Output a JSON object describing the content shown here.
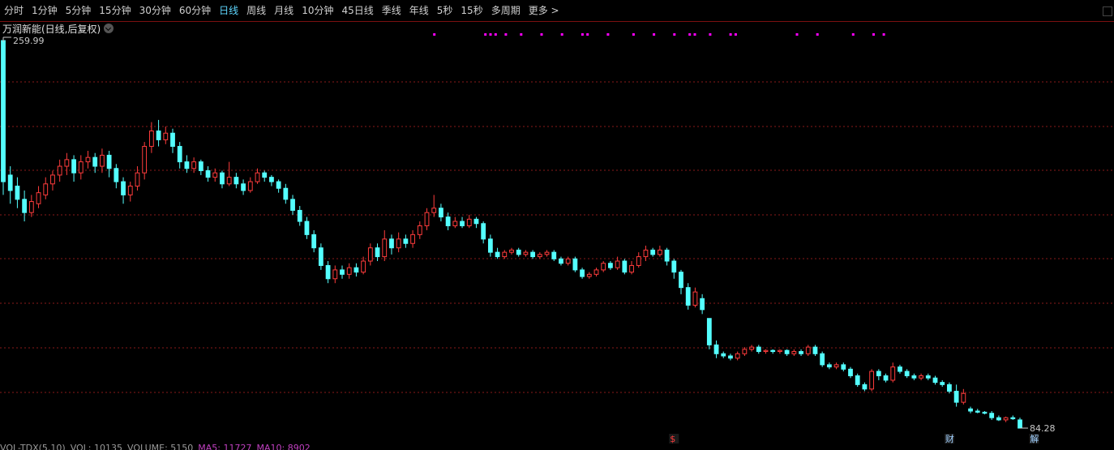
{
  "toolbar": {
    "tabs": [
      "分时",
      "1分钟",
      "5分钟",
      "15分钟",
      "30分钟",
      "60分钟",
      "日线",
      "周线",
      "月线",
      "10分钟",
      "45日线",
      "季线",
      "年线",
      "5秒",
      "15秒",
      "多周期",
      "更多 >"
    ],
    "active": "日线"
  },
  "title": "万润新能(日线,后复权)",
  "colors": {
    "up": "#ff3c3c",
    "down": "#54ffff",
    "grid": "#8a1a1a",
    "signal": "#ff00ff",
    "text": "#c8c8c8"
  },
  "labels": {
    "high": "259.99",
    "low": "84.28"
  },
  "markers": [
    {
      "text": "$",
      "color": "#ff3c3c",
      "index": 95
    },
    {
      "text": "财",
      "color": "#a0d0ff",
      "index": 134
    },
    {
      "text": "解",
      "color": "#a0d0ff",
      "index": 146
    }
  ],
  "bottom_indicators": [
    "VOL-TDX(5,10)",
    "VOL: 10135",
    "VOLUME: 5150",
    "MA5: 11727",
    "MA10: 8902"
  ],
  "chart_data": {
    "type": "candlestick",
    "title": "万润新能(日线,后复权)",
    "y_range": [
      84.28,
      259.99
    ],
    "max_label": 259.99,
    "min_label": 84.28,
    "candles": [
      [
        259.99,
        196.0,
        259.99,
        190.0
      ],
      [
        199.0,
        192.0,
        203.0,
        186.0
      ],
      [
        194.0,
        188.0,
        198.0,
        184.0
      ],
      [
        188.0,
        182.0,
        192.0,
        178.0
      ],
      [
        182.0,
        187.0,
        190.0,
        180.0
      ],
      [
        186.0,
        191.0,
        194.0,
        184.0
      ],
      [
        190.0,
        195.0,
        198.0,
        188.0
      ],
      [
        195.0,
        199.0,
        201.0,
        192.0
      ],
      [
        199.0,
        203.0,
        206.0,
        196.0
      ],
      [
        203.0,
        206.0,
        209.0,
        199.0
      ],
      [
        206.0,
        200.0,
        208.0,
        196.0
      ],
      [
        200.0,
        205.0,
        208.0,
        197.0
      ],
      [
        205.0,
        207.0,
        210.0,
        202.0
      ],
      [
        207.0,
        203.0,
        209.0,
        200.0
      ],
      [
        203.0,
        208.0,
        211.0,
        200.0
      ],
      [
        208.0,
        202.0,
        210.0,
        198.0
      ],
      [
        202.0,
        196.0,
        204.0,
        193.0
      ],
      [
        196.0,
        190.0,
        198.0,
        186.0
      ],
      [
        190.0,
        194.0,
        196.0,
        187.0
      ],
      [
        194.0,
        200.0,
        203.0,
        192.0
      ],
      [
        200.0,
        212.0,
        214.0,
        197.0
      ],
      [
        212.0,
        219.0,
        223.0,
        209.0
      ],
      [
        219.0,
        215.0,
        224.0,
        212.0
      ],
      [
        215.0,
        218.0,
        221.0,
        213.0
      ],
      [
        218.0,
        212.0,
        220.0,
        209.0
      ],
      [
        212.0,
        205.0,
        214.0,
        202.0
      ],
      [
        205.0,
        202.0,
        208.0,
        200.0
      ],
      [
        202.0,
        205.0,
        207.0,
        200.0
      ],
      [
        205.0,
        201.0,
        206.0,
        199.0
      ],
      [
        201.0,
        198.0,
        203.0,
        196.0
      ],
      [
        198.0,
        200.0,
        202.0,
        196.0
      ],
      [
        200.0,
        195.0,
        201.0,
        193.0
      ],
      [
        195.0,
        198.0,
        205.0,
        194.0
      ],
      [
        198.0,
        195.0,
        200.0,
        193.0
      ],
      [
        195.0,
        192.0,
        197.0,
        190.0
      ],
      [
        192.0,
        196.0,
        198.0,
        191.0
      ],
      [
        196.0,
        200.0,
        202.0,
        195.0
      ],
      [
        200.0,
        198.0,
        201.0,
        196.0
      ],
      [
        198.0,
        196.0,
        199.0,
        194.0
      ],
      [
        196.0,
        193.0,
        197.0,
        191.0
      ],
      [
        193.0,
        188.0,
        195.0,
        186.0
      ],
      [
        188.0,
        183.0,
        190.0,
        181.0
      ],
      [
        183.0,
        178.0,
        185.0,
        176.0
      ],
      [
        178.0,
        172.0,
        180.0,
        170.0
      ],
      [
        172.0,
        166.0,
        174.0,
        164.0
      ],
      [
        166.0,
        158.0,
        168.0,
        156.0
      ],
      [
        158.0,
        152.0,
        160.0,
        150.0
      ],
      [
        152.0,
        156.0,
        158.0,
        150.0
      ],
      [
        156.0,
        154.0,
        158.0,
        152.0
      ],
      [
        154.0,
        157.0,
        159.0,
        152.0
      ],
      [
        157.0,
        155.0,
        159.0,
        153.0
      ],
      [
        155.0,
        160.0,
        162.0,
        154.0
      ],
      [
        160.0,
        166.0,
        168.0,
        158.0
      ],
      [
        166.0,
        162.0,
        168.0,
        160.0
      ],
      [
        162.0,
        170.0,
        174.0,
        160.0
      ],
      [
        170.0,
        166.0,
        172.0,
        163.0
      ],
      [
        166.0,
        170.0,
        173.0,
        164.0
      ],
      [
        170.0,
        168.0,
        172.0,
        166.0
      ],
      [
        168.0,
        172.0,
        174.0,
        166.0
      ],
      [
        172.0,
        176.0,
        178.0,
        170.0
      ],
      [
        176.0,
        182.0,
        184.0,
        174.0
      ],
      [
        182.0,
        184.0,
        190.0,
        180.0
      ],
      [
        184.0,
        180.0,
        186.0,
        178.0
      ],
      [
        180.0,
        176.0,
        182.0,
        174.0
      ],
      [
        176.0,
        178.0,
        180.0,
        175.0
      ],
      [
        178.0,
        176.0,
        180.0,
        175.0
      ],
      [
        176.0,
        179.0,
        181.0,
        175.0
      ],
      [
        179.0,
        177.0,
        180.0,
        175.0
      ],
      [
        177.0,
        170.0,
        178.0,
        168.0
      ],
      [
        170.0,
        164.0,
        172.0,
        162.0
      ],
      [
        164.0,
        162.0,
        166.0,
        161.0
      ],
      [
        162.0,
        164.0,
        165.0,
        161.0
      ],
      [
        164.0,
        165.0,
        166.0,
        163.0
      ],
      [
        165.0,
        163.0,
        166.0,
        162.0
      ],
      [
        163.0,
        164.0,
        165.0,
        162.0
      ],
      [
        164.0,
        162.0,
        165.0,
        161.0
      ],
      [
        162.0,
        163.0,
        164.0,
        161.0
      ],
      [
        163.0,
        164.0,
        165.0,
        162.0
      ],
      [
        164.0,
        161.0,
        165.0,
        160.0
      ],
      [
        161.0,
        159.0,
        162.0,
        158.0
      ],
      [
        159.0,
        161.0,
        162.0,
        158.0
      ],
      [
        161.0,
        156.0,
        162.0,
        155.0
      ],
      [
        156.0,
        153.0,
        157.0,
        152.0
      ],
      [
        153.0,
        154.0,
        155.0,
        152.0
      ],
      [
        154.0,
        156.0,
        157.0,
        153.0
      ],
      [
        156.0,
        159.0,
        160.0,
        155.0
      ],
      [
        159.0,
        157.0,
        160.0,
        156.0
      ],
      [
        157.0,
        160.0,
        162.0,
        156.0
      ],
      [
        160.0,
        155.0,
        161.0,
        154.0
      ],
      [
        155.0,
        158.0,
        160.0,
        154.0
      ],
      [
        158.0,
        162.0,
        164.0,
        157.0
      ],
      [
        162.0,
        165.0,
        167.0,
        160.0
      ],
      [
        165.0,
        163.0,
        166.0,
        162.0
      ],
      [
        163.0,
        165.0,
        167.0,
        162.0
      ],
      [
        165.0,
        160.0,
        166.0,
        158.0
      ],
      [
        160.0,
        155.0,
        161.0,
        152.0
      ],
      [
        155.0,
        148.0,
        156.0,
        145.0
      ],
      [
        148.0,
        140.0,
        150.0,
        138.0
      ],
      [
        140.0,
        146.0,
        148.0,
        139.0
      ],
      [
        143.0,
        138.0,
        145.0,
        136.0
      ],
      [
        134.0,
        122.0,
        134.0,
        120.0
      ],
      [
        122.0,
        118.0,
        124.0,
        116.0
      ],
      [
        118.0,
        117.0,
        119.0,
        116.0
      ],
      [
        117.0,
        116.0,
        118.0,
        115.0
      ],
      [
        116.0,
        118.0,
        119.0,
        115.0
      ],
      [
        118.0,
        120.0,
        121.0,
        117.0
      ],
      [
        120.0,
        121.0,
        122.0,
        119.0
      ],
      [
        121.0,
        119.0,
        122.0,
        118.0
      ],
      [
        119.0,
        119.5,
        120.0,
        118.0
      ],
      [
        119.5,
        119.0,
        120.0,
        118.0
      ],
      [
        119.0,
        119.5,
        120.0,
        118.0
      ],
      [
        119.5,
        118.0,
        120.0,
        117.0
      ],
      [
        118.0,
        119.0,
        120.0,
        117.0
      ],
      [
        119.0,
        118.0,
        120.0,
        117.0
      ],
      [
        118.0,
        121.0,
        122.0,
        117.0
      ],
      [
        121.0,
        118.0,
        122.0,
        117.0
      ],
      [
        118.0,
        113.0,
        119.0,
        112.0
      ],
      [
        113.0,
        112.0,
        114.0,
        111.0
      ],
      [
        112.0,
        113.0,
        114.0,
        111.0
      ],
      [
        113.0,
        111.0,
        114.0,
        110.0
      ],
      [
        111.0,
        108.0,
        112.0,
        107.0
      ],
      [
        108.0,
        104.0,
        109.0,
        103.0
      ],
      [
        104.0,
        102.0,
        105.0,
        101.0
      ],
      [
        102.0,
        110.0,
        111.0,
        101.0
      ],
      [
        110.0,
        108.0,
        111.0,
        106.0
      ],
      [
        108.0,
        106.0,
        109.0,
        105.0
      ],
      [
        106.0,
        112.0,
        114.0,
        105.0
      ],
      [
        112.0,
        110.0,
        113.0,
        109.0
      ],
      [
        110.0,
        108.0,
        111.0,
        107.0
      ],
      [
        108.0,
        107.0,
        109.0,
        106.0
      ],
      [
        107.0,
        108.0,
        109.0,
        106.0
      ],
      [
        108.0,
        107.0,
        109.0,
        106.0
      ],
      [
        107.0,
        105.0,
        108.0,
        104.0
      ],
      [
        105.0,
        104.0,
        106.0,
        103.0
      ],
      [
        104.0,
        101.0,
        105.0,
        100.0
      ],
      [
        101.0,
        96.0,
        104.0,
        94.0
      ],
      [
        96.0,
        100.0,
        102.0,
        95.0
      ],
      [
        93.0,
        92.0,
        94.0,
        91.0
      ],
      [
        92.0,
        91.5,
        93.0,
        91.0
      ],
      [
        91.5,
        91.0,
        92.0,
        90.5
      ],
      [
        91.0,
        89.0,
        92.0,
        88.0
      ],
      [
        89.0,
        88.0,
        90.0,
        87.5
      ],
      [
        88.0,
        89.0,
        89.5,
        87.0
      ],
      [
        89.0,
        88.5,
        90.0,
        88.0
      ],
      [
        88.0,
        84.28,
        89.0,
        84.28
      ]
    ]
  }
}
